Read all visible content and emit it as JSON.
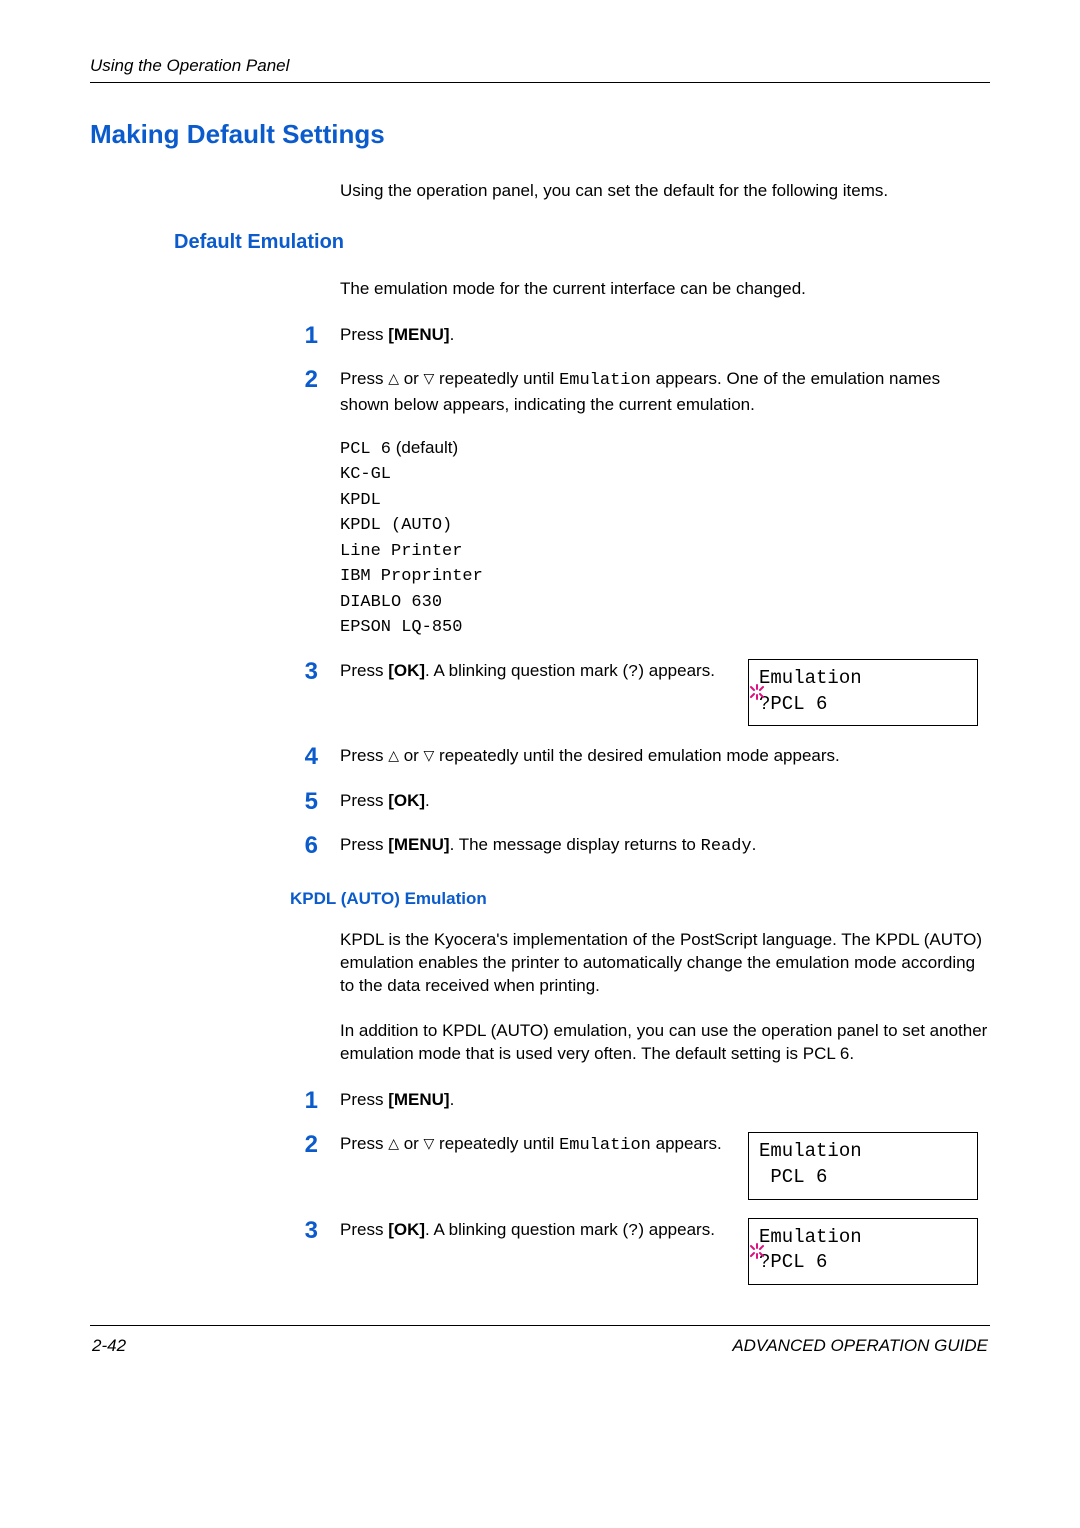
{
  "header": {
    "running_title": "Using the Operation Panel"
  },
  "h1": "Making Default Settings",
  "intro": "Using the operation panel, you can set the default for the following items.",
  "section_de": {
    "title": "Default Emulation",
    "desc": "The emulation mode for the current interface can be changed.",
    "steps": {
      "s1": {
        "n": "1",
        "prefix": "Press ",
        "btn": "[MENU]",
        "suffix": "."
      },
      "s2": {
        "n": "2",
        "t_a": "Press ",
        "t_b": " or ",
        "t_c": " repeatedly until ",
        "mono": "Emulation",
        "t_d": " appears. One of the emulation names shown below appears, indicating the current emulation.",
        "list_pcl": "PCL 6",
        "list_pcl_suffix": " (default)",
        "list_rest": "KC-GL\nKPDL\nKPDL (AUTO)\nLine Printer\nIBM Proprinter\nDIABLO 630\nEPSON LQ-850"
      },
      "s3": {
        "n": "3",
        "t_a": "Press ",
        "btn": "[OK]",
        "t_b": ". A blinking question mark (",
        "q": "?",
        "t_c": ") appears.",
        "lcd_line1": "Emulation",
        "lcd_line2": "?PCL 6"
      },
      "s4": {
        "n": "4",
        "t_a": "Press ",
        "t_b": " or ",
        "t_c": " repeatedly until the desired emulation mode appears."
      },
      "s5": {
        "n": "5",
        "t_a": "Press ",
        "btn": "[OK]",
        "t_b": "."
      },
      "s6": {
        "n": "6",
        "t_a": "Press ",
        "btn": "[MENU]",
        "t_b": ". The message display returns to ",
        "mono": "Ready",
        "t_c": "."
      }
    }
  },
  "section_kpdl": {
    "title": "KPDL (AUTO) Emulation",
    "p1": "KPDL is the Kyocera's implementation of the PostScript language. The KPDL (AUTO) emulation enables the printer to automatically change the emulation mode according to the data received when printing.",
    "p2": "In addition to KPDL (AUTO) emulation, you can use the operation panel to set another emulation mode that is used very often. The default setting is PCL 6.",
    "steps": {
      "s1": {
        "n": "1",
        "prefix": "Press ",
        "btn": "[MENU]",
        "suffix": "."
      },
      "s2": {
        "n": "2",
        "t_a": "Press ",
        "t_b": " or ",
        "t_c": " repeatedly until ",
        "mono": "Emulation",
        "t_d": " appears.",
        "lcd_line1": "Emulation",
        "lcd_line2": " PCL 6"
      },
      "s3": {
        "n": "3",
        "t_a": "Press ",
        "btn": "[OK]",
        "t_b": ". A blinking question mark (",
        "q": "?",
        "t_c": ") appears.",
        "lcd_line1": "Emulation",
        "lcd_line2": "?PCL 6"
      }
    }
  },
  "footer": {
    "page": "2-42",
    "guide": "ADVANCED OPERATION GUIDE"
  }
}
